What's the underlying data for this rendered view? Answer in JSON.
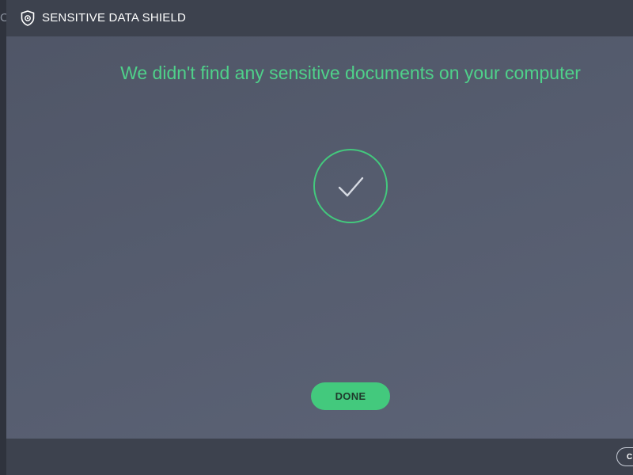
{
  "app": {
    "title": "SENSITIVE DATA SHIELD",
    "logo_icon": "shield-eye-icon"
  },
  "edge": {
    "clipped_glyph": "C"
  },
  "main": {
    "headline": "We didn't find any sensitive documents on your computer",
    "status_icon": "checkmark-circle-icon",
    "done_label": "DONE"
  },
  "footer": {
    "button_label": "C"
  },
  "colors": {
    "accent_green": "#43c97d",
    "headline_green": "#4fd18a",
    "titlebar_bg": "#3d424e",
    "content_bg": "#555c6e"
  }
}
